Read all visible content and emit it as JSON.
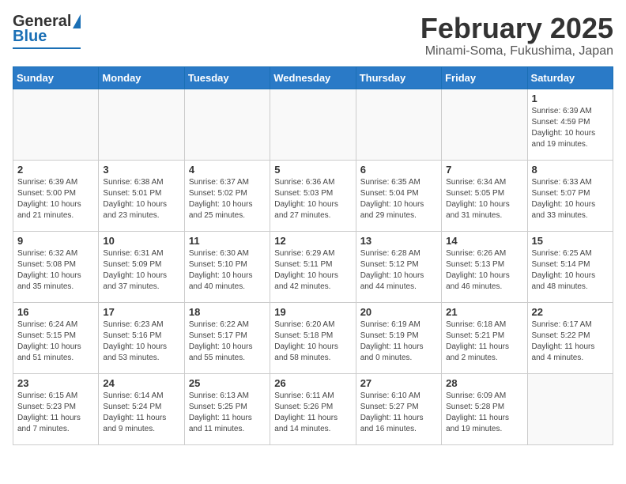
{
  "header": {
    "logo_general": "General",
    "logo_blue": "Blue",
    "month_title": "February 2025",
    "location": "Minami-Soma, Fukushima, Japan"
  },
  "weekdays": [
    "Sunday",
    "Monday",
    "Tuesday",
    "Wednesday",
    "Thursday",
    "Friday",
    "Saturday"
  ],
  "weeks": [
    [
      {
        "day": "",
        "sunrise": "",
        "sunset": "",
        "daylight": ""
      },
      {
        "day": "",
        "sunrise": "",
        "sunset": "",
        "daylight": ""
      },
      {
        "day": "",
        "sunrise": "",
        "sunset": "",
        "daylight": ""
      },
      {
        "day": "",
        "sunrise": "",
        "sunset": "",
        "daylight": ""
      },
      {
        "day": "",
        "sunrise": "",
        "sunset": "",
        "daylight": ""
      },
      {
        "day": "",
        "sunrise": "",
        "sunset": "",
        "daylight": ""
      },
      {
        "day": "1",
        "sunrise": "Sunrise: 6:39 AM",
        "sunset": "Sunset: 4:59 PM",
        "daylight": "Daylight: 10 hours and 19 minutes."
      }
    ],
    [
      {
        "day": "2",
        "sunrise": "Sunrise: 6:39 AM",
        "sunset": "Sunset: 5:00 PM",
        "daylight": "Daylight: 10 hours and 21 minutes."
      },
      {
        "day": "3",
        "sunrise": "Sunrise: 6:38 AM",
        "sunset": "Sunset: 5:01 PM",
        "daylight": "Daylight: 10 hours and 23 minutes."
      },
      {
        "day": "4",
        "sunrise": "Sunrise: 6:37 AM",
        "sunset": "Sunset: 5:02 PM",
        "daylight": "Daylight: 10 hours and 25 minutes."
      },
      {
        "day": "5",
        "sunrise": "Sunrise: 6:36 AM",
        "sunset": "Sunset: 5:03 PM",
        "daylight": "Daylight: 10 hours and 27 minutes."
      },
      {
        "day": "6",
        "sunrise": "Sunrise: 6:35 AM",
        "sunset": "Sunset: 5:04 PM",
        "daylight": "Daylight: 10 hours and 29 minutes."
      },
      {
        "day": "7",
        "sunrise": "Sunrise: 6:34 AM",
        "sunset": "Sunset: 5:05 PM",
        "daylight": "Daylight: 10 hours and 31 minutes."
      },
      {
        "day": "8",
        "sunrise": "Sunrise: 6:33 AM",
        "sunset": "Sunset: 5:07 PM",
        "daylight": "Daylight: 10 hours and 33 minutes."
      }
    ],
    [
      {
        "day": "9",
        "sunrise": "Sunrise: 6:32 AM",
        "sunset": "Sunset: 5:08 PM",
        "daylight": "Daylight: 10 hours and 35 minutes."
      },
      {
        "day": "10",
        "sunrise": "Sunrise: 6:31 AM",
        "sunset": "Sunset: 5:09 PM",
        "daylight": "Daylight: 10 hours and 37 minutes."
      },
      {
        "day": "11",
        "sunrise": "Sunrise: 6:30 AM",
        "sunset": "Sunset: 5:10 PM",
        "daylight": "Daylight: 10 hours and 40 minutes."
      },
      {
        "day": "12",
        "sunrise": "Sunrise: 6:29 AM",
        "sunset": "Sunset: 5:11 PM",
        "daylight": "Daylight: 10 hours and 42 minutes."
      },
      {
        "day": "13",
        "sunrise": "Sunrise: 6:28 AM",
        "sunset": "Sunset: 5:12 PM",
        "daylight": "Daylight: 10 hours and 44 minutes."
      },
      {
        "day": "14",
        "sunrise": "Sunrise: 6:26 AM",
        "sunset": "Sunset: 5:13 PM",
        "daylight": "Daylight: 10 hours and 46 minutes."
      },
      {
        "day": "15",
        "sunrise": "Sunrise: 6:25 AM",
        "sunset": "Sunset: 5:14 PM",
        "daylight": "Daylight: 10 hours and 48 minutes."
      }
    ],
    [
      {
        "day": "16",
        "sunrise": "Sunrise: 6:24 AM",
        "sunset": "Sunset: 5:15 PM",
        "daylight": "Daylight: 10 hours and 51 minutes."
      },
      {
        "day": "17",
        "sunrise": "Sunrise: 6:23 AM",
        "sunset": "Sunset: 5:16 PM",
        "daylight": "Daylight: 10 hours and 53 minutes."
      },
      {
        "day": "18",
        "sunrise": "Sunrise: 6:22 AM",
        "sunset": "Sunset: 5:17 PM",
        "daylight": "Daylight: 10 hours and 55 minutes."
      },
      {
        "day": "19",
        "sunrise": "Sunrise: 6:20 AM",
        "sunset": "Sunset: 5:18 PM",
        "daylight": "Daylight: 10 hours and 58 minutes."
      },
      {
        "day": "20",
        "sunrise": "Sunrise: 6:19 AM",
        "sunset": "Sunset: 5:19 PM",
        "daylight": "Daylight: 11 hours and 0 minutes."
      },
      {
        "day": "21",
        "sunrise": "Sunrise: 6:18 AM",
        "sunset": "Sunset: 5:21 PM",
        "daylight": "Daylight: 11 hours and 2 minutes."
      },
      {
        "day": "22",
        "sunrise": "Sunrise: 6:17 AM",
        "sunset": "Sunset: 5:22 PM",
        "daylight": "Daylight: 11 hours and 4 minutes."
      }
    ],
    [
      {
        "day": "23",
        "sunrise": "Sunrise: 6:15 AM",
        "sunset": "Sunset: 5:23 PM",
        "daylight": "Daylight: 11 hours and 7 minutes."
      },
      {
        "day": "24",
        "sunrise": "Sunrise: 6:14 AM",
        "sunset": "Sunset: 5:24 PM",
        "daylight": "Daylight: 11 hours and 9 minutes."
      },
      {
        "day": "25",
        "sunrise": "Sunrise: 6:13 AM",
        "sunset": "Sunset: 5:25 PM",
        "daylight": "Daylight: 11 hours and 11 minutes."
      },
      {
        "day": "26",
        "sunrise": "Sunrise: 6:11 AM",
        "sunset": "Sunset: 5:26 PM",
        "daylight": "Daylight: 11 hours and 14 minutes."
      },
      {
        "day": "27",
        "sunrise": "Sunrise: 6:10 AM",
        "sunset": "Sunset: 5:27 PM",
        "daylight": "Daylight: 11 hours and 16 minutes."
      },
      {
        "day": "28",
        "sunrise": "Sunrise: 6:09 AM",
        "sunset": "Sunset: 5:28 PM",
        "daylight": "Daylight: 11 hours and 19 minutes."
      },
      {
        "day": "",
        "sunrise": "",
        "sunset": "",
        "daylight": ""
      }
    ]
  ]
}
